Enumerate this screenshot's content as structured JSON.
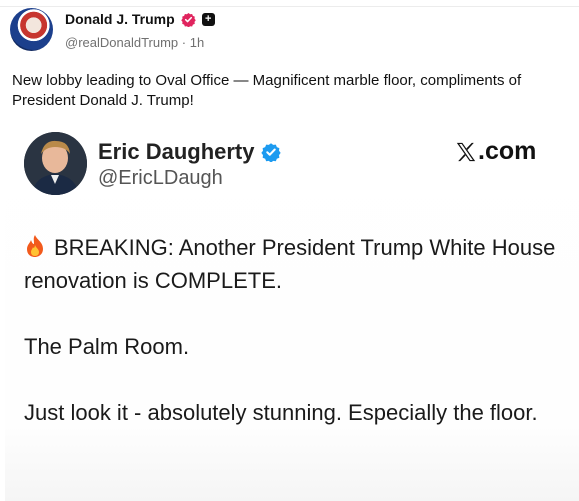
{
  "post": {
    "author_name": "Donald J. Trump",
    "author_handle": "@realDonaldTrump",
    "separator": "·",
    "time": "1h",
    "text": "New lobby leading to Oval Office — Magnificent marble floor, compliments of President Donald J. Trump!",
    "badge_glyph": "+"
  },
  "embed": {
    "author_name": "Eric Daugherty",
    "author_handle": "@EricLDaugh",
    "site": ".com",
    "paragraphs": [
      "BREAKING: Another President Trump White House renovation is COMPLETE.",
      "The Palm Room.",
      "Just look it - absolutely stunning. Especially the floor."
    ]
  },
  "icons": {
    "verified_pink": "verified-badge-icon",
    "verified_blue": "verified-badge-icon",
    "x_logo": "x-logo-icon",
    "fire": "fire-emoji-icon"
  },
  "colors": {
    "verified_pink": "#e0245e",
    "verified_blue": "#1d9bf0",
    "handle_gray": "#707070"
  }
}
